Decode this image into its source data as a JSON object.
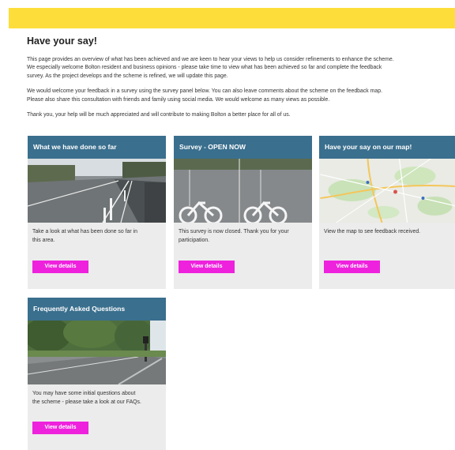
{
  "page": {
    "title": "Have your say!",
    "intro": {
      "p1_line1": "This page provides an overview of what has been achieved and we are keen to hear your views to help us consider refinements to enhance the scheme.",
      "p1_line2": "We especially welcome Bolton resident and business opinions - please take time to view what has been achieved so far and complete the feedback",
      "p1_line3": "survey. As the project develops and the scheme is refined, we will update this page.",
      "p2_line1": "We would welcome your feedback in a survey using the survey panel below. You can also leave comments about the scheme on the feedback map.",
      "p2_line2": "Please also share this consultation with friends and family using social media. We would welcome as many views as possible.",
      "p3_line1": "Thank you, your help will be much appreciated and will contribute to making Bolton a better place for all of us."
    }
  },
  "colors": {
    "banner": "#fddd3a",
    "card_header": "#3a6f8e",
    "card_bg": "#ececec",
    "button": "#ee22dd"
  },
  "cards": [
    {
      "title": "What we have done so far",
      "text_line1": "Take a look at what has been done so far in",
      "text_line2": "this area.",
      "button": "View details",
      "image": "wet-road-cycle-lane-photo"
    },
    {
      "title": "Survey - OPEN NOW",
      "text_line1": "This survey is now closed. Thank you for your",
      "text_line2": "participation.",
      "button": "View details",
      "image": "cycle-lane-symbol-photo"
    },
    {
      "title": "Have your say on our map!",
      "text_line1": "View the map to see feedback received.",
      "text_line2": "",
      "button": "View details",
      "image": "area-map-thumbnail"
    },
    {
      "title": "Frequently Asked Questions",
      "text_line1": "You may have some initial questions about",
      "text_line2": "the scheme - please take a look at our FAQs.",
      "button": "View details",
      "image": "tree-lined-road-photo"
    }
  ]
}
